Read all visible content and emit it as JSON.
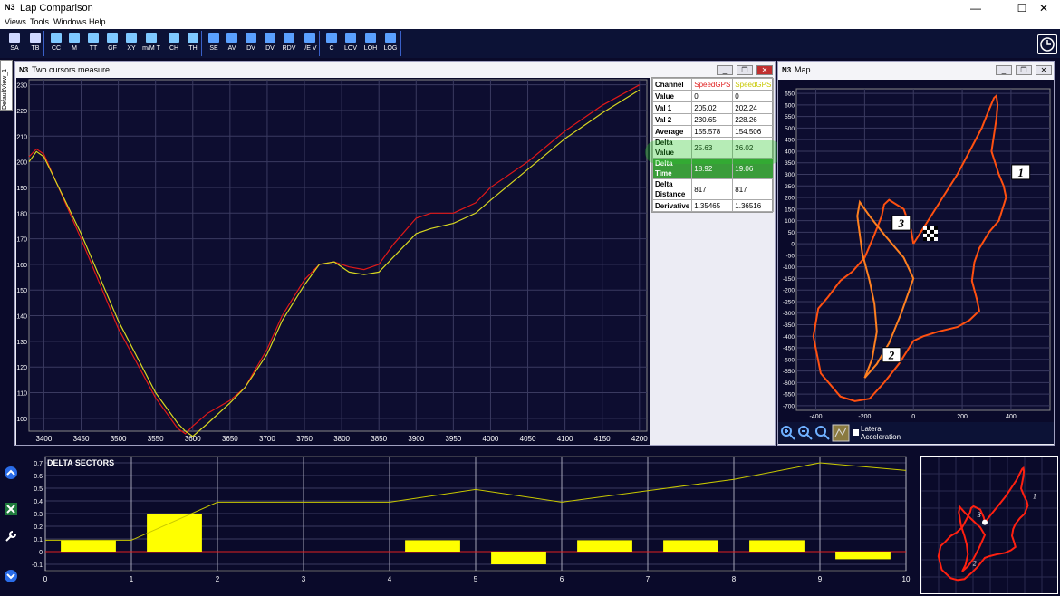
{
  "app": {
    "title": "Lap Comparison",
    "logo": "N3"
  },
  "window_buttons": {
    "minimize": "—",
    "maximize": "☐",
    "close": "✕"
  },
  "menu": [
    "Views",
    "Tools",
    "Windows",
    "Help"
  ],
  "toolbar": [
    {
      "label": "SA",
      "icon": "window-icon"
    },
    {
      "label": "TB",
      "icon": "hourglass-icon"
    },
    {
      "label": "CC",
      "icon": "curve-icon"
    },
    {
      "label": "M",
      "icon": "map-icon"
    },
    {
      "label": "TT",
      "icon": "calendar-icon"
    },
    {
      "label": "GF",
      "icon": "target-icon"
    },
    {
      "label": "XY",
      "icon": "xy-icon"
    },
    {
      "label": "m/M T",
      "icon": "table-icon"
    },
    {
      "label": "CH",
      "icon": "bars-icon"
    },
    {
      "label": "TH",
      "icon": "histogram-icon"
    },
    {
      "label": "SE",
      "icon": "save-icon"
    },
    {
      "label": "AV",
      "icon": "monitor-icon"
    },
    {
      "label": "DV",
      "icon": "monitor-icon"
    },
    {
      "label": "DV",
      "icon": "monitor-icon"
    },
    {
      "label": "RDV",
      "icon": "monitor-icon"
    },
    {
      "label": "I/E V",
      "icon": "import-export-icon"
    },
    {
      "label": "C",
      "icon": "cascade-icon"
    },
    {
      "label": "LOV",
      "icon": "rows-icon"
    },
    {
      "label": "LOH",
      "icon": "columns-icon"
    },
    {
      "label": "LOG",
      "icon": "grid-icon"
    }
  ],
  "side_tab": "DefaultView_1",
  "cursor_window": {
    "title": "Two cursors measure",
    "table": {
      "headers": [
        "Channel",
        "SpeedGPS",
        "SpeedGPS"
      ],
      "header_colors": [
        "#000000",
        "#e02020",
        "#c8c800"
      ],
      "rows": [
        {
          "label": "Value",
          "a": "0",
          "b": "0"
        },
        {
          "label": "Val 1",
          "a": "205.02",
          "b": "202.24"
        },
        {
          "label": "Val 2",
          "a": "230.65",
          "b": "228.26"
        },
        {
          "label": "Average",
          "a": "155.578",
          "b": "154.506"
        },
        {
          "label": "Delta Value",
          "a": "25.63",
          "b": "26.02"
        },
        {
          "label": "Delta Time",
          "a": "18.92",
          "b": "19.06",
          "highlight": true
        },
        {
          "label": "Delta Distance",
          "a": "817",
          "b": "817"
        },
        {
          "label": "Derivative",
          "a": "1.35465",
          "b": "1.36516"
        }
      ]
    }
  },
  "map_window": {
    "title": "Map",
    "marker_labels": [
      "1",
      "2",
      "3"
    ],
    "tool_label": "Lateral Acceleration"
  },
  "delta_sectors": {
    "title": "DELTA SECTORS"
  },
  "chart_data": [
    {
      "type": "line",
      "title": "",
      "x_ticks": [
        3400,
        3450,
        3500,
        3550,
        3600,
        3650,
        3700,
        3750,
        3800,
        3850,
        3900,
        3950,
        4000,
        4050,
        4100,
        4150,
        4200
      ],
      "y_ticks": [
        100,
        110,
        120,
        130,
        140,
        150,
        160,
        170,
        180,
        190,
        200,
        210,
        220,
        230
      ],
      "xlim": [
        3380,
        4210
      ],
      "ylim": [
        95,
        232
      ],
      "grid": true,
      "series": [
        {
          "color": "#e01818",
          "x": [
            3380,
            3390,
            3400,
            3450,
            3500,
            3550,
            3580,
            3590,
            3600,
            3620,
            3650,
            3670,
            3700,
            3720,
            3750,
            3770,
            3790,
            3810,
            3830,
            3850,
            3870,
            3900,
            3920,
            3950,
            3980,
            4000,
            4050,
            4100,
            4150,
            4200
          ],
          "y": [
            202,
            205,
            203,
            170,
            135,
            108,
            96,
            94,
            97,
            102,
            107,
            112,
            127,
            140,
            154,
            160,
            161,
            159,
            158,
            160,
            168,
            178,
            180,
            180,
            184,
            190,
            200,
            212,
            222,
            230
          ]
        },
        {
          "color": "#d8d820",
          "x": [
            3380,
            3390,
            3400,
            3450,
            3500,
            3550,
            3580,
            3590,
            3600,
            3620,
            3650,
            3670,
            3700,
            3720,
            3750,
            3770,
            3790,
            3810,
            3830,
            3850,
            3870,
            3900,
            3920,
            3950,
            3980,
            4000,
            4050,
            4100,
            4150,
            4200
          ],
          "y": [
            200,
            204,
            202,
            172,
            138,
            110,
            98,
            95,
            93,
            98,
            106,
            112,
            125,
            138,
            152,
            160,
            161,
            157,
            156,
            157,
            163,
            172,
            174,
            176,
            180,
            185,
            197,
            209,
            219,
            228
          ]
        }
      ]
    },
    {
      "type": "line",
      "title": "",
      "x_ticks": [
        -400,
        -200,
        0,
        200,
        400
      ],
      "y_ticks": [
        650,
        600,
        550,
        500,
        450,
        400,
        350,
        300,
        250,
        200,
        150,
        100,
        50,
        0,
        -50,
        -100,
        -150,
        -200,
        -250,
        -300,
        -350,
        -400,
        -450,
        -500,
        -550,
        -600,
        -650,
        -700
      ],
      "xlim": [
        -480,
        560
      ],
      "ylim": [
        -720,
        670
      ],
      "grid": true,
      "series": [
        {
          "name": "outer",
          "color": "#ff5010",
          "x": [
            0,
            60,
            120,
            180,
            230,
            280,
            310,
            330,
            340,
            345,
            340,
            330,
            320,
            350,
            370,
            380,
            350,
            310,
            270,
            250,
            240,
            260,
            270,
            230,
            180,
            100,
            40,
            0,
            -60,
            -120,
            -180,
            -240,
            -300,
            -380,
            -410,
            -390,
            -350,
            -300,
            -250,
            -200,
            -160,
            -130,
            -120,
            -100,
            -40,
            -10,
            0
          ],
          "y": [
            0,
            100,
            200,
            300,
            400,
            500,
            580,
            630,
            640,
            600,
            540,
            470,
            400,
            300,
            250,
            200,
            100,
            50,
            -20,
            -80,
            -160,
            -240,
            -290,
            -330,
            -360,
            -380,
            -400,
            -420,
            -520,
            -600,
            -670,
            -680,
            -660,
            -560,
            -400,
            -280,
            -230,
            -160,
            -120,
            -60,
            40,
            120,
            170,
            190,
            150,
            60,
            0
          ]
        },
        {
          "name": "inner",
          "color": "#ff8020",
          "x": [
            -200,
            -150,
            -100,
            -50,
            0,
            -40,
            -80,
            -120,
            -180,
            -220,
            -230,
            -210,
            -180,
            -160,
            -150,
            -170,
            -200
          ],
          "y": [
            -580,
            -520,
            -430,
            -300,
            -150,
            -60,
            -10,
            40,
            120,
            180,
            120,
            -40,
            -160,
            -260,
            -380,
            -500,
            -580
          ]
        }
      ]
    },
    {
      "type": "bar",
      "title": "DELTA SECTORS",
      "categories": [
        "1",
        "2",
        "3",
        "4",
        "5",
        "6",
        "7",
        "8",
        "9",
        "10"
      ],
      "x_ticks": [
        0,
        1,
        2,
        3,
        4,
        5,
        6,
        7,
        8,
        9,
        10
      ],
      "y_ticks": [
        -0.1,
        0.0,
        0.1,
        0.2,
        0.3,
        0.4,
        0.5,
        0.6,
        0.7
      ],
      "ylim": [
        -0.15,
        0.75
      ],
      "xlim": [
        0,
        10
      ],
      "grid": true,
      "values": [
        0.09,
        0.3,
        0.0,
        0.0,
        0.09,
        -0.1,
        0.09,
        0.09,
        0.09,
        -0.06
      ],
      "cumulative": {
        "x": [
          0,
          1,
          2,
          3,
          4,
          5,
          6,
          7,
          8,
          9,
          10
        ],
        "y": [
          0.09,
          0.09,
          0.39,
          0.39,
          0.39,
          0.49,
          0.39,
          0.48,
          0.57,
          0.7,
          0.64
        ]
      },
      "colors": {
        "bars": "#ffff00",
        "line": "#c8c800",
        "zero_line": "#e02020"
      }
    }
  ]
}
